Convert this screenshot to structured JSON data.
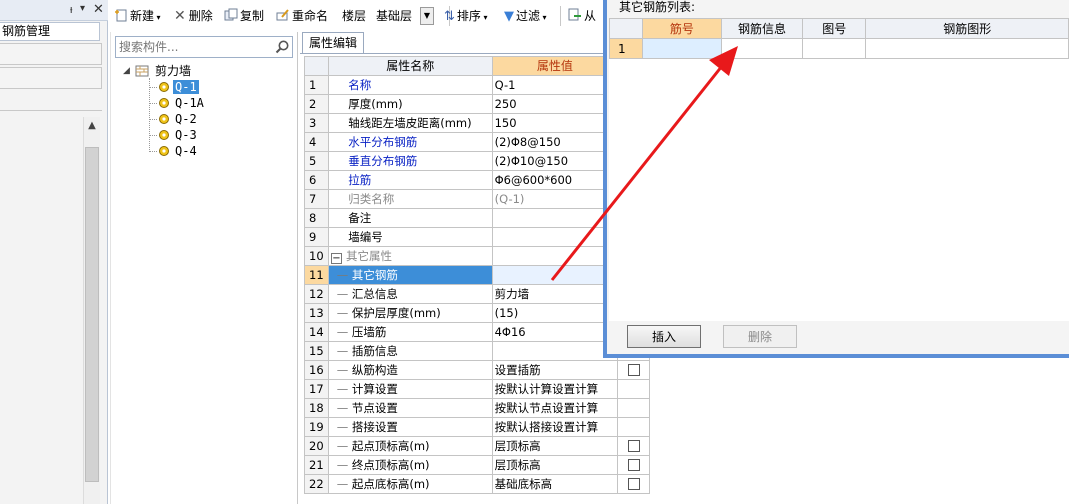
{
  "left_panel": {
    "tab_label": "钢筋管理"
  },
  "toolbar": {
    "new_label": "新建",
    "delete_label": "删除",
    "copy_label": "复制",
    "rename_label": "重命名",
    "floor_label": "楼层",
    "floor_value": "基础层",
    "sort_label": "排序",
    "filter_label": "过滤",
    "from_label": "从"
  },
  "tree": {
    "search_placeholder": "搜索构件...",
    "root": "剪力墙",
    "items": [
      "Q-1",
      "Q-1A",
      "Q-2",
      "Q-3",
      "Q-4"
    ],
    "selected": "Q-1"
  },
  "property_panel": {
    "tab_label": "属性编辑",
    "col_name": "属性名称",
    "col_value": "属性值",
    "rows": [
      {
        "no": "1",
        "name": "名称",
        "value": "Q-1",
        "style": "blue",
        "checkbox": false
      },
      {
        "no": "2",
        "name": "厚度(mm)",
        "value": "250",
        "style": "normal",
        "checkbox": false
      },
      {
        "no": "3",
        "name": "轴线距左墙皮距离(mm)",
        "value": "150",
        "style": "normal",
        "checkbox": false
      },
      {
        "no": "4",
        "name": "水平分布钢筋",
        "value": "(2)Φ8@150",
        "style": "blue",
        "checkbox": false
      },
      {
        "no": "5",
        "name": "垂直分布钢筋",
        "value": "(2)Φ10@150",
        "style": "blue",
        "checkbox": false
      },
      {
        "no": "6",
        "name": "拉筋",
        "value": "Φ6@600*600",
        "style": "blue",
        "checkbox": false
      },
      {
        "no": "7",
        "name": "归类名称",
        "value": "(Q-1)",
        "style": "gray",
        "checkbox": false
      },
      {
        "no": "8",
        "name": "备注",
        "value": "",
        "style": "normal",
        "checkbox": false
      },
      {
        "no": "9",
        "name": "墙编号",
        "value": "",
        "style": "normal",
        "checkbox": false
      },
      {
        "no": "10",
        "name": "其它属性",
        "value": "",
        "style": "group",
        "checkbox": false
      },
      {
        "no": "11",
        "name": "其它钢筋",
        "value": "",
        "style": "child",
        "checkbox": false
      },
      {
        "no": "12",
        "name": "汇总信息",
        "value": "剪力墙",
        "style": "child",
        "checkbox": false
      },
      {
        "no": "13",
        "name": "保护层厚度(mm)",
        "value": "(15)",
        "style": "child",
        "checkbox": false
      },
      {
        "no": "14",
        "name": "压墙筋",
        "value": "4Φ16",
        "style": "child",
        "checkbox": false
      },
      {
        "no": "15",
        "name": "插筋信息",
        "value": "",
        "style": "child",
        "checkbox": false
      },
      {
        "no": "16",
        "name": "纵筋构造",
        "value": "设置插筋",
        "style": "child",
        "checkbox": true
      },
      {
        "no": "17",
        "name": "计算设置",
        "value": "按默认计算设置计算",
        "style": "child",
        "checkbox": false
      },
      {
        "no": "18",
        "name": "节点设置",
        "value": "按默认节点设置计算",
        "style": "child",
        "checkbox": false
      },
      {
        "no": "19",
        "name": "搭接设置",
        "value": "按默认搭接设置计算",
        "style": "child",
        "checkbox": false
      },
      {
        "no": "20",
        "name": "起点顶标高(m)",
        "value": "层顶标高",
        "style": "child",
        "checkbox": true
      },
      {
        "no": "21",
        "name": "终点顶标高(m)",
        "value": "层顶标高",
        "style": "child",
        "checkbox": true
      },
      {
        "no": "22",
        "name": "起点底标高(m)",
        "value": "基础底标高",
        "style": "child",
        "checkbox": true
      }
    ],
    "selected_row": "11"
  },
  "dialog": {
    "title": "其它钢筋列表:",
    "columns": [
      "筋号",
      "钢筋信息",
      "图号",
      "钢筋图形"
    ],
    "rows": [
      {
        "no": "1"
      }
    ],
    "insert_label": "插入",
    "delete_label": "删除"
  },
  "colors": {
    "accent_blue": "#5b8ed6",
    "header_orange": "#fcd9a0",
    "selection_blue": "#3d8ed8",
    "arrow_red": "#e8191b"
  }
}
